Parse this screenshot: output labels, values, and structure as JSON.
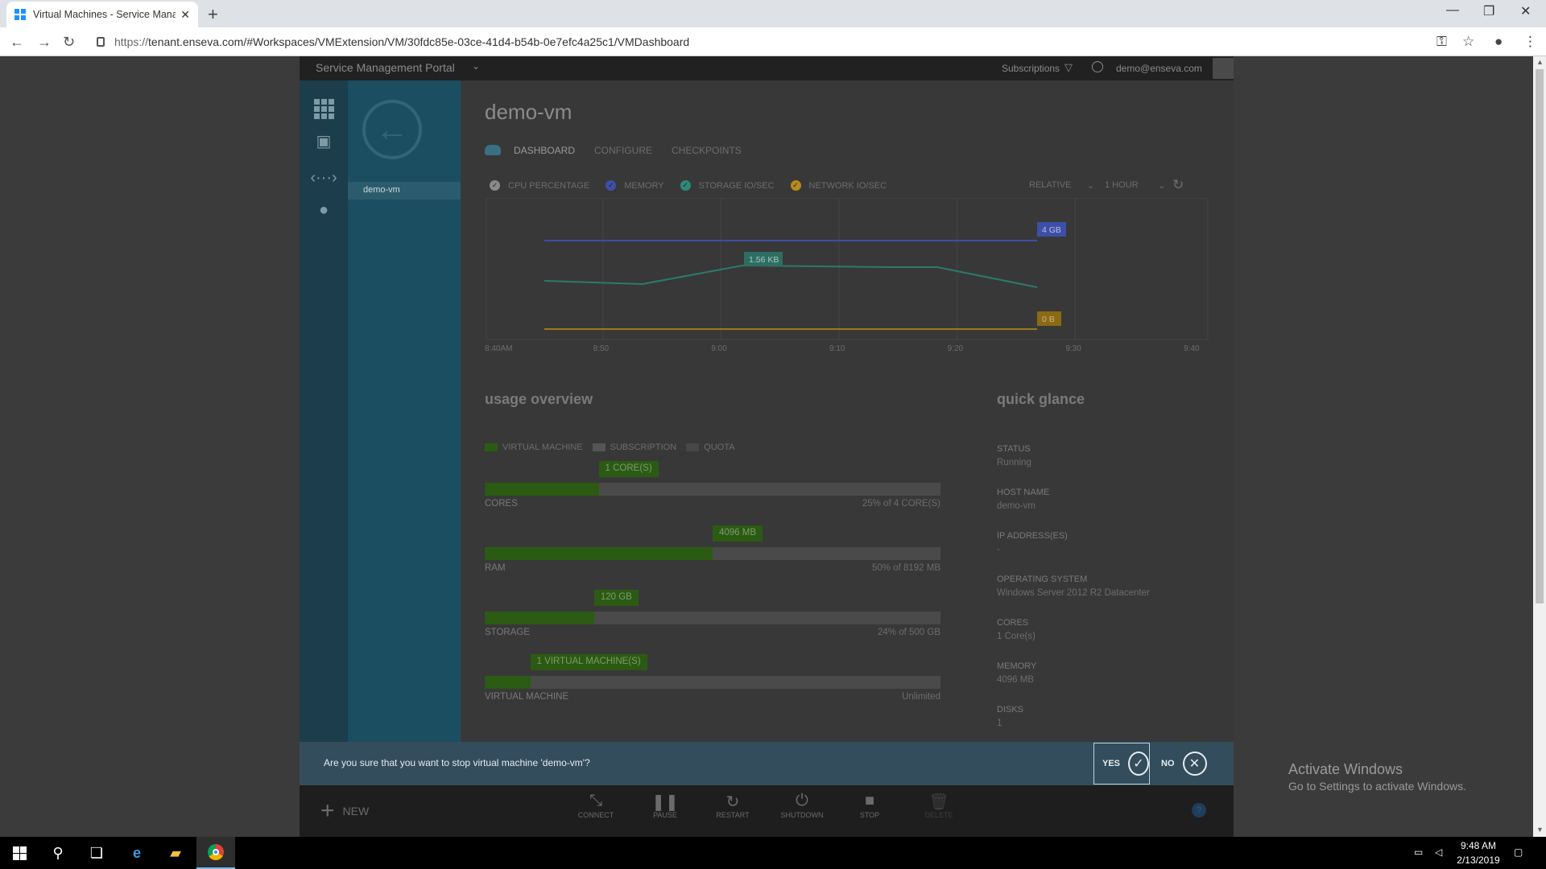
{
  "browser": {
    "tab_title": "Virtual Machines - Service Manag",
    "url_proto": "https://",
    "url_rest": "tenant.enseva.com/#Workspaces/VMExtension/VM/30fdc85e-03ce-41d4-b54b-0e7efc4a25c1/VMDashboard"
  },
  "portal": {
    "brand": "Service Management Portal",
    "subscriptions_label": "Subscriptions",
    "user": "demo@enseva.com",
    "nav_item": "demo-vm"
  },
  "vm": {
    "title": "demo-vm",
    "tabs": [
      "DASHBOARD",
      "CONFIGURE",
      "CHECKPOINTS"
    ]
  },
  "metrics": {
    "items": [
      {
        "label": "CPU PERCENTAGE",
        "color": "#8a8a8a"
      },
      {
        "label": "MEMORY",
        "color": "#3d4fa8"
      },
      {
        "label": "STORAGE IO/SEC",
        "color": "#2d8a78"
      },
      {
        "label": "NETWORK IO/SEC",
        "color": "#b88a1c"
      }
    ],
    "range_mode": "RELATIVE",
    "range_window": "1 HOUR"
  },
  "chart_data": {
    "type": "line",
    "x": [
      "8:40AM",
      "8:50",
      "9:00",
      "9:10",
      "9:20",
      "9:30",
      "9:40"
    ],
    "series": [
      {
        "name": "MEMORY",
        "color": "#3d4fa8",
        "label": "4 GB"
      },
      {
        "name": "STORAGE IO/SEC",
        "color": "#2d7a6a",
        "label": "1.56 KB"
      },
      {
        "name": "NETWORK IO/SEC",
        "color": "#9a7a1c",
        "label": "0 B"
      }
    ]
  },
  "usage": {
    "title": "usage overview",
    "legend": [
      "VIRTUAL MACHINE",
      "SUBSCRIPTION",
      "QUOTA"
    ],
    "bars": [
      {
        "label": "CORES",
        "tag": "1 CORE(S)",
        "pct_text": "25% of 4 CORE(S)",
        "fill": 0.25
      },
      {
        "label": "RAM",
        "tag": "4096 MB",
        "pct_text": "50% of 8192 MB",
        "fill": 0.5
      },
      {
        "label": "STORAGE",
        "tag": "120 GB",
        "pct_text": "24% of 500 GB",
        "fill": 0.24
      },
      {
        "label": "VIRTUAL MACHINE",
        "tag": "1 VIRTUAL MACHINE(S)",
        "pct_text": "Unlimited",
        "fill": 0.1
      }
    ]
  },
  "quick_glance": {
    "title": "quick glance",
    "items": [
      {
        "key": "STATUS",
        "value": "Running"
      },
      {
        "key": "HOST NAME",
        "value": "demo-vm"
      },
      {
        "key": "IP ADDRESS(ES)",
        "value": "-"
      },
      {
        "key": "OPERATING SYSTEM",
        "value": "Windows Server 2012 R2 Datacenter"
      },
      {
        "key": "CORES",
        "value": "1 Core(s)"
      },
      {
        "key": "MEMORY",
        "value": "4096 MB"
      },
      {
        "key": "DISKS",
        "value": "1"
      }
    ]
  },
  "confirm": {
    "message": "Are you sure that you want to stop virtual machine 'demo-vm'?",
    "yes": "YES",
    "no": "NO"
  },
  "commands": {
    "new": "NEW",
    "items": [
      "CONNECT",
      "PAUSE",
      "RESTART",
      "SHUTDOWN",
      "STOP",
      "DELETE"
    ]
  },
  "watermark": {
    "line1": "Activate Windows",
    "line2": "Go to Settings to activate Windows."
  },
  "taskbar": {
    "time": "9:48 AM",
    "date": "2/13/2019"
  }
}
